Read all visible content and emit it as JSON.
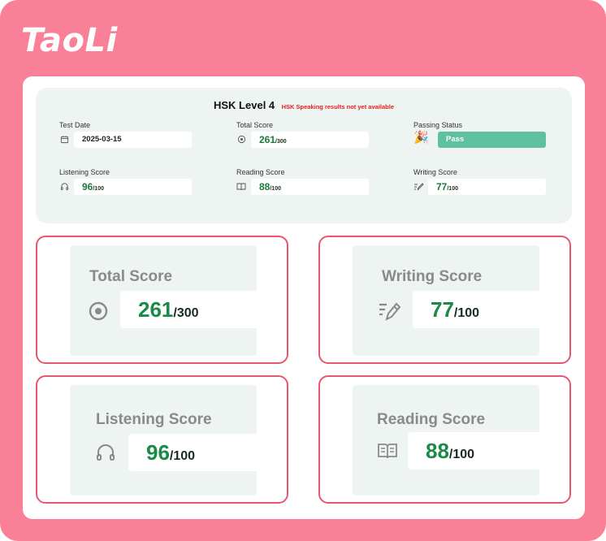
{
  "brand": {
    "logo_text": "TaoLi"
  },
  "summary": {
    "title": "HSK Level 4",
    "notice": "HSK Speaking results not yet available",
    "test_date": {
      "label": "Test Date",
      "value": "2025-03-15",
      "icon": "calendar-icon"
    },
    "total_score": {
      "label": "Total Score",
      "value": "261",
      "unit": "/300",
      "icon": "target-icon"
    },
    "passing_status": {
      "label": "Passing Status",
      "value": "Pass",
      "icon": "party-popper-icon",
      "emoji": "🎉"
    },
    "listening_score": {
      "label": "Listening Score",
      "value": "96",
      "unit": "/100",
      "icon": "headphones-icon"
    },
    "reading_score": {
      "label": "Reading Score",
      "value": "88",
      "unit": "/100",
      "icon": "book-icon"
    },
    "writing_score": {
      "label": "Writing Score",
      "value": "77",
      "unit": "/100",
      "icon": "pen-icon"
    }
  },
  "score_cards": {
    "total": {
      "title": "Total Score",
      "value": "261",
      "unit": "/300",
      "icon": "target-icon"
    },
    "writing": {
      "title": "Writing Score",
      "value": "77",
      "unit": "/100",
      "icon": "pen-icon"
    },
    "listening": {
      "title": "Listening Score",
      "value": "96",
      "unit": "/100",
      "icon": "headphones-icon"
    },
    "reading": {
      "title": "Reading Score",
      "value": "88",
      "unit": "/100",
      "icon": "book-icon"
    }
  },
  "colors": {
    "frame": "#f98096",
    "card_border": "#e85670",
    "panel_bg": "#eef4f2",
    "score_green": "#1a8a47",
    "pass_bg": "#5fc0a0",
    "notice_red": "#e02020"
  }
}
